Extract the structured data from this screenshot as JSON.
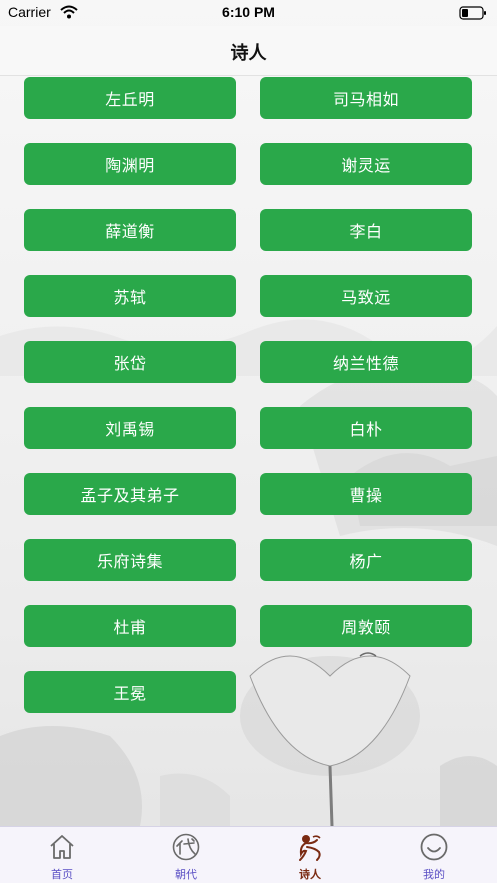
{
  "status_bar": {
    "carrier": "Carrier",
    "time": "6:10 PM"
  },
  "nav": {
    "title": "诗人"
  },
  "poets": [
    "左丘明",
    "司马相如",
    "陶渊明",
    "谢灵运",
    "薛道衡",
    "李白",
    "苏轼",
    "马致远",
    "张岱",
    "纳兰性德",
    "刘禹锡",
    "白朴",
    "孟子及其弟子",
    "曹操",
    "乐府诗集",
    "杨广",
    "杜甫",
    "周敦颐",
    "王冕"
  ],
  "tabs": [
    {
      "label": "首页",
      "icon": "home-icon"
    },
    {
      "label": "朝代",
      "icon": "dynasty-icon"
    },
    {
      "label": "诗人",
      "icon": "poet-icon",
      "active": true
    },
    {
      "label": "我的",
      "icon": "profile-icon"
    }
  ],
  "colors": {
    "button": "#2aa84a",
    "tab_inactive": "#5a4fc4",
    "tab_active": "#7a2a12"
  }
}
